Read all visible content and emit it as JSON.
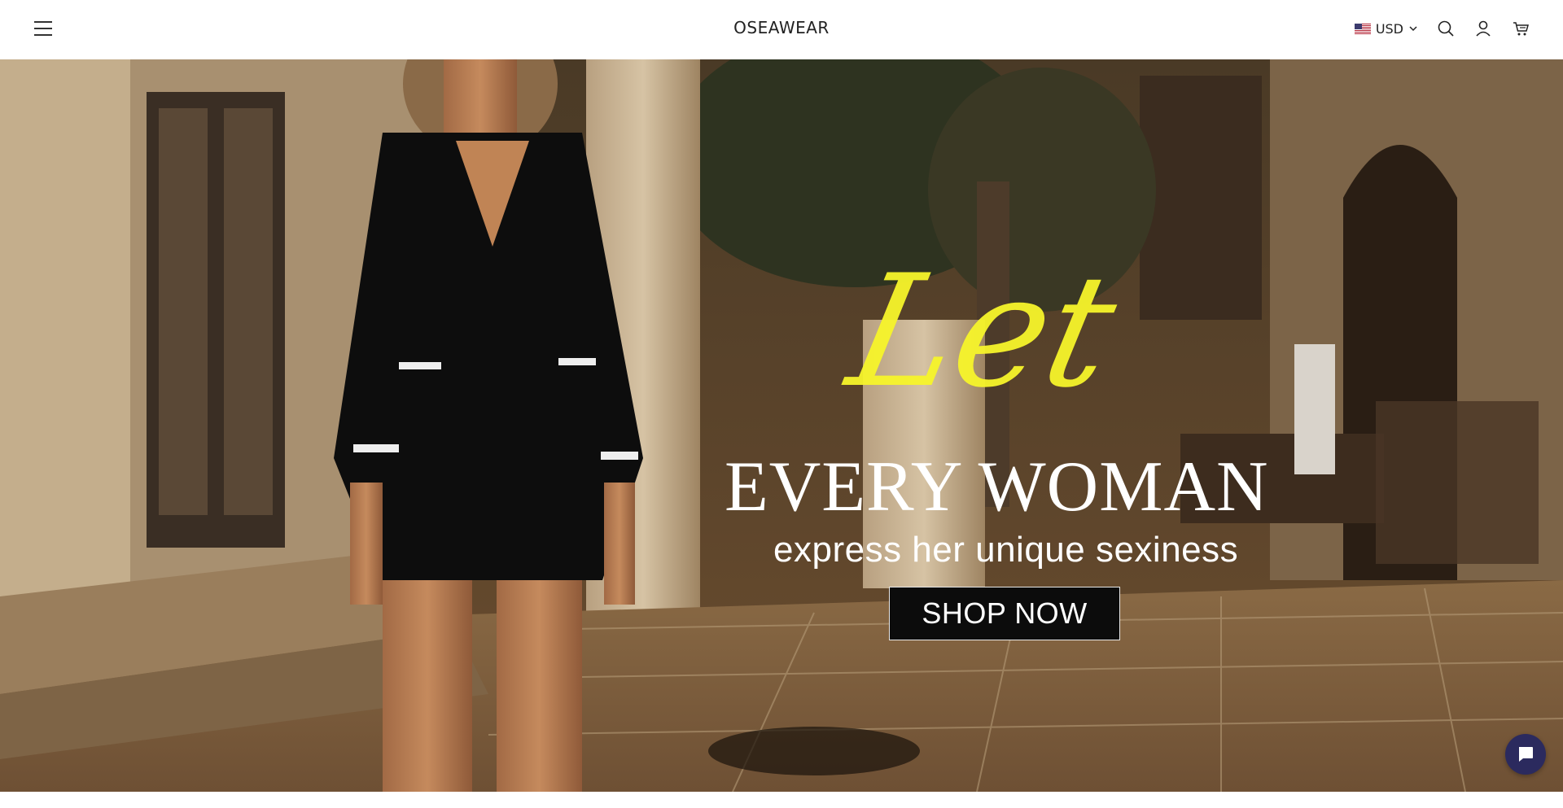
{
  "header": {
    "menu_icon": "hamburger-menu-icon",
    "logo": "OSEAWEAR",
    "currency": {
      "flag": "us-flag-icon",
      "label": "USD",
      "dropdown_icon": "chevron-down-icon"
    },
    "icons": [
      "search-icon",
      "account-icon",
      "cart-icon"
    ]
  },
  "hero": {
    "script_text": "Let",
    "headline": "EVERY WOMAN",
    "subline": "express her unique sexiness",
    "cta_label": "SHOP NOW",
    "colors": {
      "script": "#f7f52b",
      "text": "#ffffff",
      "button_bg": "#0c0c0c"
    }
  },
  "chat": {
    "icon": "chat-bubble-icon",
    "color": "#2b2a5e"
  }
}
